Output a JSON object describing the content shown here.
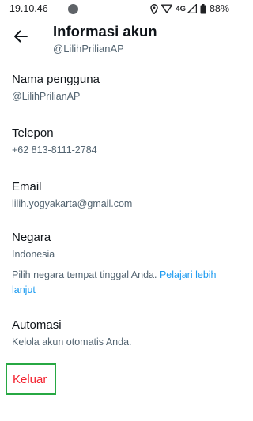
{
  "status_bar": {
    "time": "19.10.46",
    "network": "4G",
    "battery": "88%",
    "icons": [
      "notification-dot-icon",
      "location-icon",
      "wifi-icon",
      "signal-icon",
      "battery-icon"
    ]
  },
  "header": {
    "title": "Informasi akun",
    "username": "@LilihPrilianAP",
    "back_icon": "arrow-left-icon"
  },
  "items": [
    {
      "label": "Nama pengguna",
      "value": "@LilihPrilianAP"
    },
    {
      "label": "Telepon",
      "value": "+62 813-8111-2784"
    },
    {
      "label": "Email",
      "value": "lilih.yogyakarta@gmail.com"
    },
    {
      "label": "Negara",
      "value": "Indonesia"
    },
    {
      "label": "Automasi",
      "value": "Kelola akun otomatis Anda."
    }
  ],
  "country_note": {
    "text": "Pilih negara tempat tinggal Anda. ",
    "link": "Pelajari lebih lanjut"
  },
  "logout_label": "Keluar",
  "colors": {
    "link": "#1d9bf0",
    "danger": "#f4212e",
    "highlight_border": "#27a843",
    "secondary_text": "#536471"
  }
}
